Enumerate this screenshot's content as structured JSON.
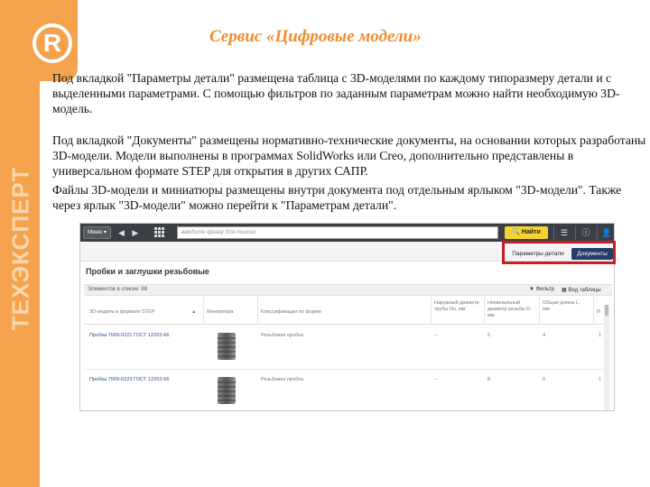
{
  "slide": {
    "title": "Сервис «Цифровые модели»",
    "paragraph1": "Под вкладкой \"Параметры детали\" размещена таблица с 3D-моделями по каждому типоразмеру детали и с выделенными параметрами. С помощью фильтров по заданным параметрам можно найти необходимую 3D-модель.",
    "paragraph2": "Под вкладкой \"Документы\" размещены нормативно-технические документы, на основании которых разработаны 3D-модели. Модели выполнены в программах SolidWorks или Creo, дополнительно представлены в универсальном формате STEP для открытия в других САПР.",
    "paragraph3": "Файлы 3D-модели и миниатюры размещены внутри документа под отдельным ярлыком \"3D-модели\". Также через ярлык \"3D-модели\" можно перейти к \"Параметрам детали\".",
    "brand_vertical": "ТЕХЭКСПЕРТ",
    "logo_letter": "R"
  },
  "screenshot": {
    "menu_label": "Меню ▾",
    "search_placeholder": "введите фразу для поиска",
    "find_button": "Найти",
    "tab_params": "Параметры детали",
    "tab_docs": "Документы",
    "page_title": "Пробки и заглушки резьбовые",
    "count_label": "Элементов в списке: 88",
    "filter_label": "Фильтр",
    "view_table_label": "Вид таблицы",
    "columns": [
      "3D-модель в формате STEP",
      "Миниатюра",
      "Классификация по форме",
      "Наружный диаметр трубы Dн, мм",
      "Номинальный диаметр резьбы D, мм",
      "Общая длина L, мм",
      "И"
    ],
    "rows": [
      {
        "model": "Пробка 7009-0221 ГОСТ 12202-66",
        "classification": "Резьбовая пробка",
        "c1": "–",
        "c2": "6",
        "c3": "4",
        "c4": "1"
      },
      {
        "model": "Пробка 7009-0223 ГОСТ 12202-66",
        "classification": "Резьбовая пробка",
        "c1": "–",
        "c2": "8",
        "c3": "6",
        "c4": "1"
      }
    ]
  },
  "colors": {
    "brand_orange": "#F4A24C",
    "title_orange": "#F08C2C",
    "highlight_red": "#c62026",
    "docs_tab_blue": "#253d66",
    "find_yellow": "#F6D32D"
  }
}
